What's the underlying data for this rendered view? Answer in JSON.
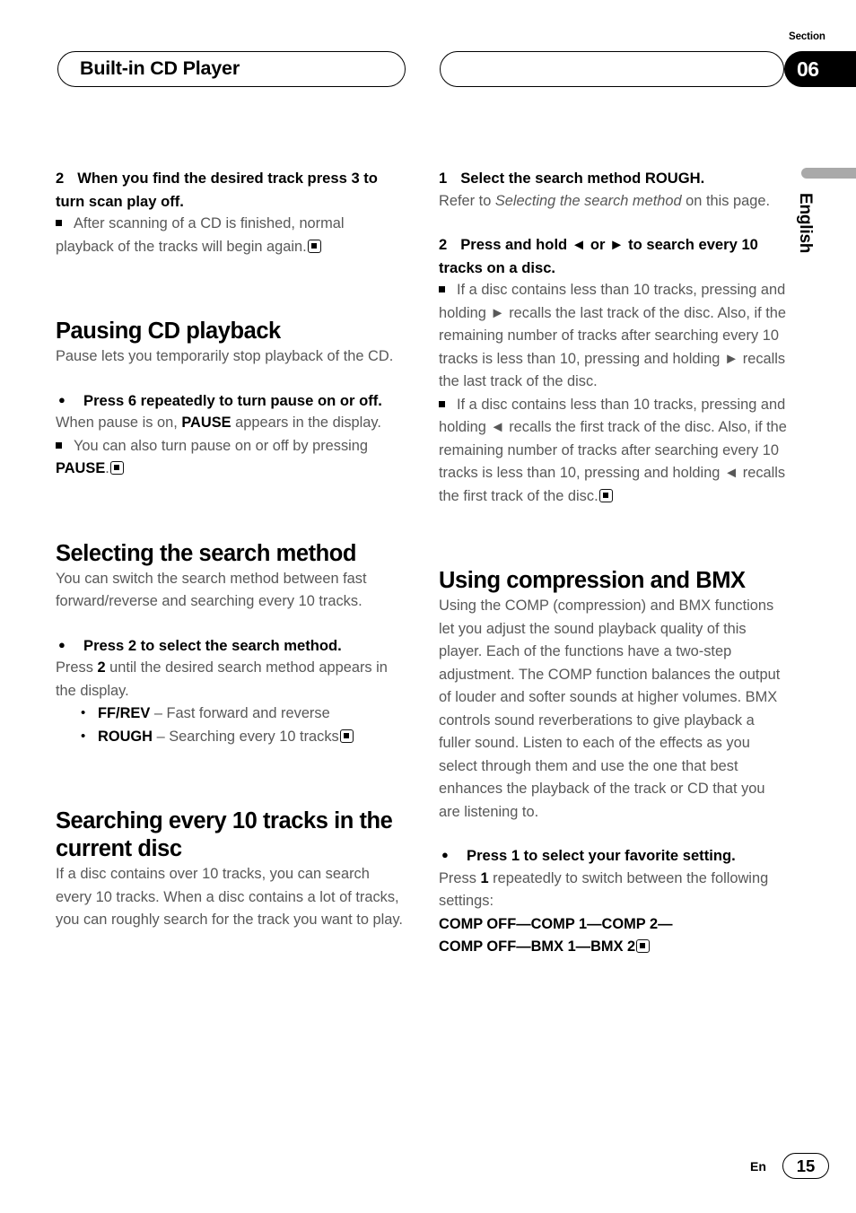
{
  "header": {
    "title": "Built-in CD Player",
    "right_pill_text": "",
    "section_label": "Section",
    "section_number": "06"
  },
  "side_tab": {
    "language": "English"
  },
  "footer": {
    "lang_code": "En",
    "page_number": "15"
  },
  "left_column": {
    "step2": {
      "num": "2",
      "text": "When you find the desired track press 3 to turn scan play off."
    },
    "step2_note": "After scanning of a CD is finished, normal playback of the tracks will begin again.",
    "pausing": {
      "heading": "Pausing CD playback",
      "intro": "Pause lets you temporarily stop playback of the CD.",
      "action": "Press 6 repeatedly to turn pause on or off.",
      "body_a": "When pause is on, ",
      "body_b": "PAUSE",
      "body_c": " appears in the display.",
      "note_a": "You can also turn pause on or off by pressing ",
      "note_b": "PAUSE",
      "note_c": "."
    },
    "selecting": {
      "heading": "Selecting the search method",
      "intro": "You can switch the search method between fast forward/reverse and searching every 10 tracks.",
      "action": "Press 2 to select the search method.",
      "body_a": "Press ",
      "body_b": "2",
      "body_c": " until the desired search method appears in the display.",
      "option1_label": "FF/REV",
      "option1_text": " – Fast forward and reverse",
      "option2_label": "ROUGH",
      "option2_text": " – Searching every 10 tracks"
    },
    "searching": {
      "heading": "Searching every 10 tracks in the current disc",
      "intro": "If a disc contains over 10 tracks, you can search every 10 tracks. When a disc contains a lot of tracks, you can roughly search for the track you want to play."
    }
  },
  "right_column": {
    "step1": {
      "num": "1",
      "text": "Select the search method ROUGH."
    },
    "step1_body_a": "Refer to ",
    "step1_body_italic": "Selecting the search method",
    "step1_body_b": " on this page.",
    "step2": {
      "num": "2",
      "text": "Press and hold ◄ or ► to search every 10 tracks on a disc."
    },
    "note1": "If a disc contains less than 10 tracks, pressing and holding ► recalls the last track of the disc. Also, if the remaining number of tracks after searching every 10 tracks is less than 10, pressing and holding ► recalls the last track of the disc.",
    "note2": "If a disc contains less than 10 tracks, pressing and holding ◄ recalls the first track of the disc. Also, if the remaining number of tracks after searching every 10 tracks is less than 10, pressing and holding ◄ recalls the first track of the disc.",
    "compression": {
      "heading": "Using compression and BMX",
      "intro": "Using the COMP (compression) and BMX functions let you adjust the sound playback quality of this player. Each of the functions have a two-step adjustment. The COMP function balances the output of louder and softer sounds at higher volumes. BMX controls sound reverberations to give playback a fuller sound. Listen to each of the effects as you select through them and use the one that best enhances the playback of the track or CD that you are listening to.",
      "action": "Press 1 to select your favorite setting.",
      "body_a": "Press ",
      "body_b": "1",
      "body_c": " repeatedly to switch between the following settings:",
      "settings_line1": "COMP OFF—COMP 1—COMP 2—",
      "settings_line2": "COMP OFF—BMX 1—BMX 2"
    }
  }
}
